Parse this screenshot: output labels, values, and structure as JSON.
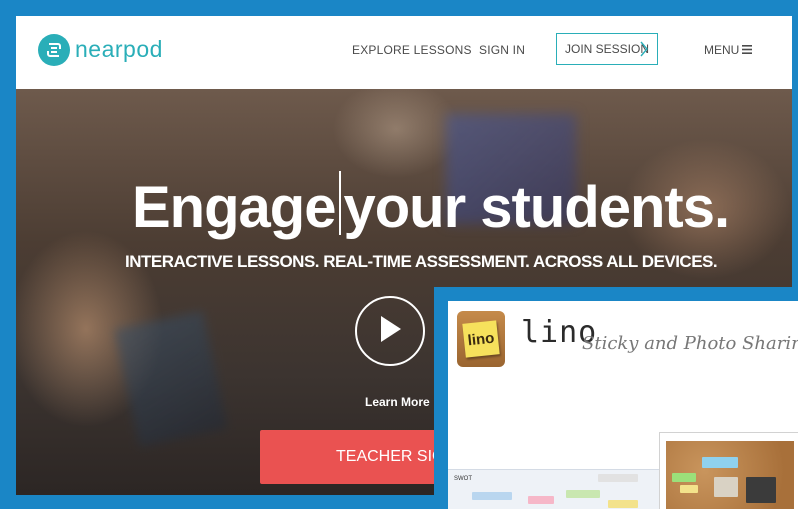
{
  "header": {
    "brand": "nearpod",
    "nav": {
      "explore": "EXPLORE LESSONS",
      "signin": "SIGN IN",
      "join": "JOIN SESSION",
      "menu": "MENU"
    },
    "icons": {
      "menu": "hamburger-icon",
      "join": "chevron-right-icon",
      "logo": "nearpod-logo-icon"
    }
  },
  "hero": {
    "headline_a": "Engage",
    "headline_b": "your students.",
    "subline": "INTERACTIVE LESSONS. REAL-TIME ASSESSMENT. ACROSS ALL DEVICES.",
    "play_icon": "play-icon",
    "learn_more": "Learn More",
    "signup": "TEACHER SIGN U"
  },
  "overlay_window": {
    "logo_text": "lino",
    "name": "lino",
    "tagline": "Sticky and Photo Sharin",
    "board_label": "SWOT"
  },
  "colors": {
    "accent": "#2aaeb8",
    "cta": "#ea5251",
    "frame": "#1a86c6"
  }
}
